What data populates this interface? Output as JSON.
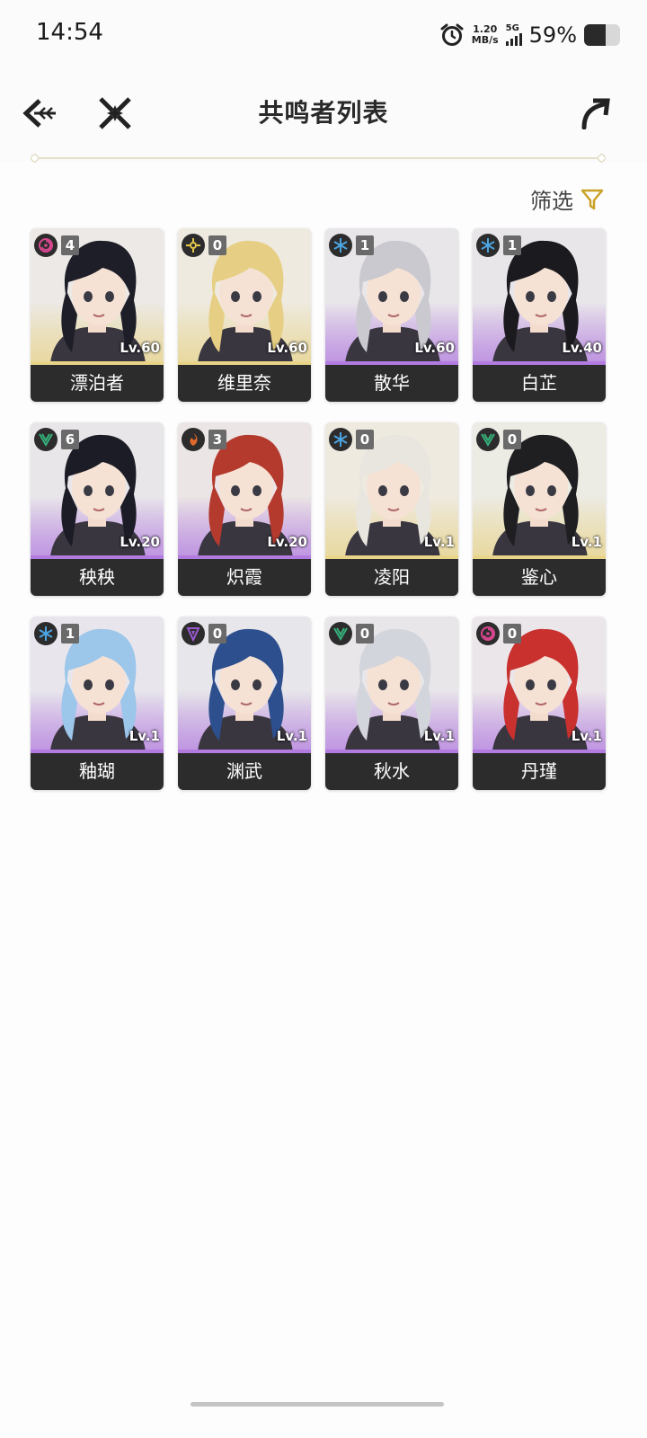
{
  "status_bar": {
    "time": "14:54",
    "net_speed_value": "1.20",
    "net_speed_unit": "MB/s",
    "network": "5G",
    "battery_text": "59%",
    "battery_level": 0.59
  },
  "header": {
    "title": "共鸣者列表",
    "back_icon": "back-arrow-icon",
    "close_icon": "close-icon",
    "share_icon": "share-icon"
  },
  "filter": {
    "label": "筛选",
    "icon": "filter-icon"
  },
  "colors": {
    "five_star": "#e9d58a",
    "four_star": "#b27be0",
    "name_bar": "#2c2c2c",
    "element_badge_bg": "#2c2c2c"
  },
  "characters": [
    {
      "name": "漂泊者",
      "count": "4",
      "level": "Lv.60",
      "element": "havoc",
      "rarity": 5
    },
    {
      "name": "维里奈",
      "count": "0",
      "level": "Lv.60",
      "element": "spectro",
      "rarity": 5
    },
    {
      "name": "散华",
      "count": "1",
      "level": "Lv.60",
      "element": "glacio",
      "rarity": 4
    },
    {
      "name": "白芷",
      "count": "1",
      "level": "Lv.40",
      "element": "glacio",
      "rarity": 4
    },
    {
      "name": "秧秧",
      "count": "6",
      "level": "Lv.20",
      "element": "aero",
      "rarity": 4
    },
    {
      "name": "炽霞",
      "count": "3",
      "level": "Lv.20",
      "element": "fusion",
      "rarity": 4
    },
    {
      "name": "凌阳",
      "count": "0",
      "level": "Lv.1",
      "element": "glacio",
      "rarity": 5
    },
    {
      "name": "鉴心",
      "count": "0",
      "level": "Lv.1",
      "element": "aero",
      "rarity": 5
    },
    {
      "name": "釉瑚",
      "count": "1",
      "level": "Lv.1",
      "element": "glacio",
      "rarity": 4
    },
    {
      "name": "渊武",
      "count": "0",
      "level": "Lv.1",
      "element": "electro",
      "rarity": 4
    },
    {
      "name": "秋水",
      "count": "0",
      "level": "Lv.1",
      "element": "aero",
      "rarity": 4
    },
    {
      "name": "丹瑾",
      "count": "0",
      "level": "Lv.1",
      "element": "havoc",
      "rarity": 4
    }
  ]
}
